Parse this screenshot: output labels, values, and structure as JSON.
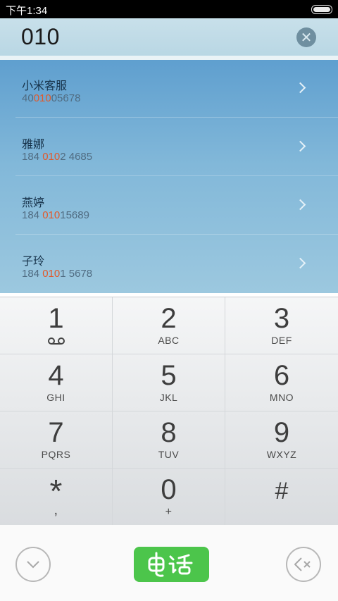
{
  "status_bar": {
    "time": "下午1:34"
  },
  "dialer": {
    "input_value": "010",
    "results": [
      {
        "name": "小米客服",
        "number_pre": "40",
        "number_match": "010",
        "number_post": "05678"
      },
      {
        "name": "雅娜",
        "number_pre": "184 ",
        "number_match": "010",
        "number_post": "2 4685"
      },
      {
        "name": "燕婷",
        "number_pre": "184 ",
        "number_match": "010",
        "number_post": "15689"
      },
      {
        "name": "子玲",
        "number_pre": "184 ",
        "number_match": "010",
        "number_post": "1 5678"
      }
    ],
    "keys": [
      {
        "digit": "1",
        "letters": ""
      },
      {
        "digit": "2",
        "letters": "ABC"
      },
      {
        "digit": "3",
        "letters": "DEF"
      },
      {
        "digit": "4",
        "letters": "GHI"
      },
      {
        "digit": "5",
        "letters": "JKL"
      },
      {
        "digit": "6",
        "letters": "MNO"
      },
      {
        "digit": "7",
        "letters": "PQRS"
      },
      {
        "digit": "8",
        "letters": "TUV"
      },
      {
        "digit": "9",
        "letters": "WXYZ"
      },
      {
        "digit": "*",
        "letters": ","
      },
      {
        "digit": "0",
        "letters": "+"
      },
      {
        "digit": "#",
        "letters": ""
      }
    ]
  },
  "colors": {
    "highlight": "#e2582a",
    "call_button": "#4cc54b",
    "results_background": "#7fb5d8"
  },
  "icons": {
    "clear": "close-circle-icon",
    "collapse": "chevron-down-icon",
    "call": "phone-call-icon",
    "backspace": "backspace-icon",
    "voicemail": "voicemail-icon"
  }
}
